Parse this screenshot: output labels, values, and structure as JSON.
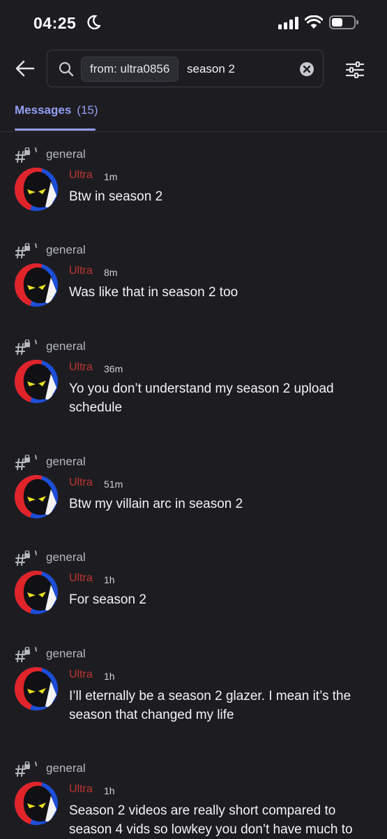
{
  "status_bar": {
    "time": "04:25"
  },
  "search": {
    "filter_chip": "from: ultra0856",
    "query": "season 2"
  },
  "tabs": {
    "messages_label": "Messages",
    "messages_count": "(15)"
  },
  "results": [
    {
      "channel": "general",
      "username": "Ultra",
      "time": "1m",
      "text": "Btw in season 2"
    },
    {
      "channel": "general",
      "username": "Ultra",
      "time": "8m",
      "text": "Was like that in season 2 too"
    },
    {
      "channel": "general",
      "username": "Ultra",
      "time": "36m",
      "text": "Yo you don’t understand my season 2 upload schedule"
    },
    {
      "channel": "general",
      "username": "Ultra",
      "time": "51m",
      "text": "Btw my villain arc in season 2"
    },
    {
      "channel": "general",
      "username": "Ultra",
      "time": "1h",
      "text": "For season 2"
    },
    {
      "channel": "general",
      "username": "Ultra",
      "time": "1h",
      "text": "I’ll eternally be a season 2 glazer. I mean it’s the season that changed my life"
    },
    {
      "channel": "general",
      "username": "Ultra",
      "time": "1h",
      "text": "Season 2 videos are really short compared to season 4 vids so lowkey you don’t have much to"
    }
  ],
  "colors": {
    "background": "#1d1d21",
    "accent": "#959ff6",
    "username": "#c0352f"
  },
  "icons": {
    "back": "arrow-left-icon",
    "search": "search-icon",
    "clear": "clear-x-icon",
    "filter": "sliders-icon",
    "channel": "hashtag-lock-icon"
  }
}
